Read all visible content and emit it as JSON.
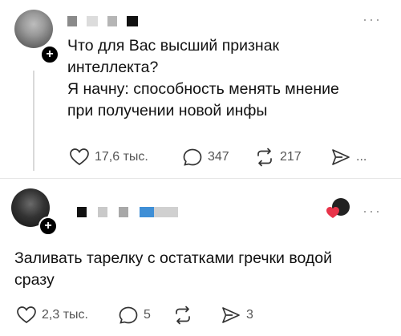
{
  "post1": {
    "text_lines": [
      "Что для Вас высший признак",
      "интеллекта?",
      "Я начну: способность менять мнение",
      "при получении новой инфы"
    ],
    "likes": "17,6 тыс.",
    "comments": "347",
    "reposts": "217",
    "shares": "..."
  },
  "post2": {
    "text_lines": [
      "Заливать тарелку с остатками гречки водой",
      "сразу"
    ],
    "likes": "2,3 тыс.",
    "comments": "5",
    "reposts": "",
    "shares": "3"
  },
  "more_label": "···",
  "plus_label": "+",
  "colors": {
    "heart_badge": "#e8344a",
    "redact_blue": "#3f8fd6"
  }
}
